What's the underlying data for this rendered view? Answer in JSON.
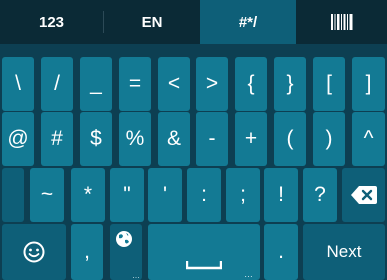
{
  "tabs": [
    {
      "label": "123"
    },
    {
      "label": "EN"
    },
    {
      "label": "#*/"
    },
    {
      "label": ""
    }
  ],
  "rows": [
    [
      "\\",
      "/",
      "_",
      "=",
      "<",
      ">",
      "{",
      "}",
      "[",
      "]"
    ],
    [
      "@",
      "#",
      "$",
      "%",
      "&",
      "-",
      "+",
      "(",
      ")",
      "^"
    ],
    [
      "~",
      "*",
      "\"",
      "'",
      ":",
      ";",
      "!",
      "?"
    ]
  ],
  "bottom": {
    "comma": ",",
    "period": ".",
    "next_label": "Next",
    "space_sub": "…",
    "period_sub": "…",
    "globe_sub": "…"
  },
  "colors": {
    "background": "#0d3f52",
    "tabbar": "#0b2a36",
    "key": "#137a94",
    "key_dark": "#0e5f78",
    "text": "#ffffff"
  },
  "icons": [
    "barcode-icon",
    "backspace-icon",
    "emoji-icon",
    "globe-icon",
    "space-bar-icon"
  ]
}
